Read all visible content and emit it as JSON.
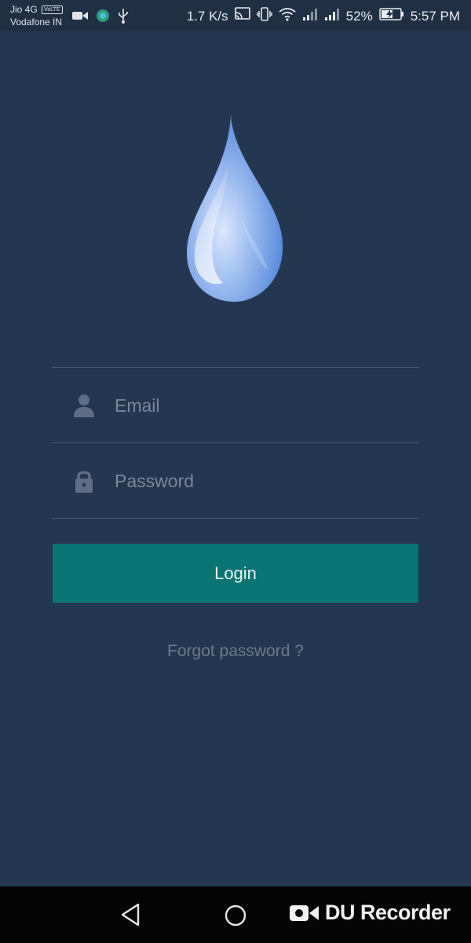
{
  "status_bar": {
    "carrier_line1": "Jio 4G",
    "volte_badge": "VoLTE",
    "carrier_line2": "Vodafone IN",
    "net_speed": "1.7 K/s",
    "battery_percent": "52%",
    "time": "5:57 PM",
    "icons": [
      "video-camera-icon",
      "app-notification-icon",
      "usb-icon",
      "cast-icon",
      "vibrate-icon",
      "wifi-icon",
      "signal-icon",
      "signal-icon",
      "battery-charging-icon"
    ]
  },
  "logo": {
    "icon": "water-drop-icon"
  },
  "form": {
    "email_placeholder": "Email",
    "email_value": "",
    "password_placeholder": "Password",
    "password_value": "",
    "email_icon": "user-icon",
    "password_icon": "lock-icon",
    "login_label": "Login",
    "forgot_label": "Forgot password ?"
  },
  "nav_bar": {
    "back_icon": "back-triangle-icon",
    "home_icon": "home-circle-icon",
    "recorder_label": "DU Recorder",
    "recorder_icon": "video-camera-icon"
  },
  "colors": {
    "background": "#233750",
    "accent": "#0b7574",
    "divider": "#4a5b72",
    "placeholder": "#7b8797",
    "drop_light": "#c9dcf7",
    "drop_dark": "#5b8ee0"
  }
}
